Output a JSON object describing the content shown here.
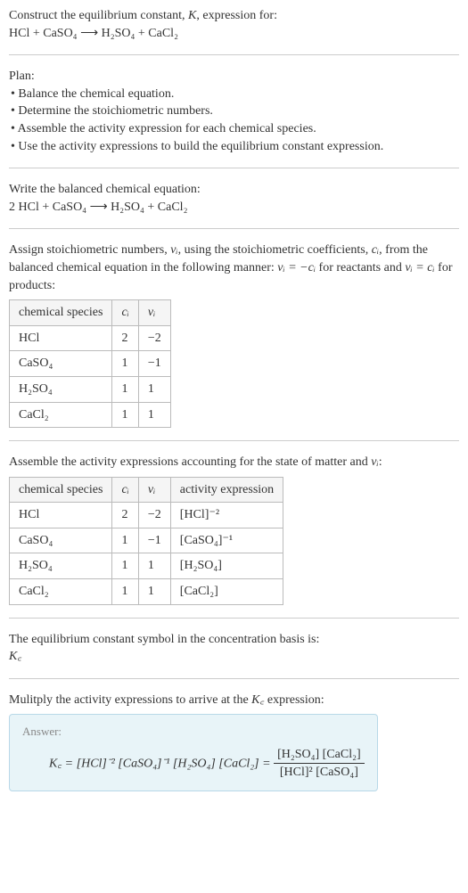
{
  "prompt": {
    "line1": "Construct the equilibrium constant, ",
    "K": "K",
    "line1b": ", expression for:",
    "equation": "HCl + CaSO₄  ⟶  H₂SO₄ + CaCl₂"
  },
  "plan": {
    "title": "Plan:",
    "bullets": [
      "• Balance the chemical equation.",
      "• Determine the stoichiometric numbers.",
      "• Assemble the activity expression for each chemical species.",
      "• Use the activity expressions to build the equilibrium constant expression."
    ]
  },
  "balanced": {
    "title": "Write the balanced chemical equation:",
    "equation": "2 HCl + CaSO₄  ⟶  H₂SO₄ + CaCl₂"
  },
  "stoich": {
    "intro1": "Assign stoichiometric numbers, ",
    "nu": "νᵢ",
    "intro2": ", using the stoichiometric coefficients, ",
    "ci": "cᵢ",
    "intro3": ", from the balanced chemical equation in the following manner: ",
    "rel1": "νᵢ = −cᵢ",
    "intro4": " for reactants and ",
    "rel2": "νᵢ = cᵢ",
    "intro5": " for products:",
    "headers": [
      "chemical species",
      "cᵢ",
      "νᵢ"
    ],
    "rows": [
      {
        "species": "HCl",
        "c": "2",
        "nu": "−2"
      },
      {
        "species": "CaSO₄",
        "c": "1",
        "nu": "−1"
      },
      {
        "species": "H₂SO₄",
        "c": "1",
        "nu": "1"
      },
      {
        "species": "CaCl₂",
        "c": "1",
        "nu": "1"
      }
    ]
  },
  "activity": {
    "title1": "Assemble the activity expressions accounting for the state of matter and ",
    "nu": "νᵢ",
    "title2": ":",
    "headers": [
      "chemical species",
      "cᵢ",
      "νᵢ",
      "activity expression"
    ],
    "rows": [
      {
        "species": "HCl",
        "c": "2",
        "nu": "−2",
        "expr": "[HCl]⁻²"
      },
      {
        "species": "CaSO₄",
        "c": "1",
        "nu": "−1",
        "expr": "[CaSO₄]⁻¹"
      },
      {
        "species": "H₂SO₄",
        "c": "1",
        "nu": "1",
        "expr": "[H₂SO₄]"
      },
      {
        "species": "CaCl₂",
        "c": "1",
        "nu": "1",
        "expr": "[CaCl₂]"
      }
    ]
  },
  "symbol": {
    "title": "The equilibrium constant symbol in the concentration basis is:",
    "value": "K꜀"
  },
  "multiply": {
    "title1": "Mulitply the activity expressions to arrive at the ",
    "kc": "K꜀",
    "title2": " expression:"
  },
  "answer": {
    "label": "Answer:",
    "lhs_pre": "K꜀ = [HCl]⁻² [CaSO₄]⁻¹ [H₂SO₄] [CaCl₂] = ",
    "num": "[H₂SO₄] [CaCl₂]",
    "den": "[HCl]² [CaSO₄]"
  },
  "chart_data": {
    "type": "table",
    "tables": [
      {
        "title": "Stoichiometric numbers",
        "headers": [
          "chemical species",
          "c_i",
          "nu_i"
        ],
        "rows": [
          [
            "HCl",
            2,
            -2
          ],
          [
            "CaSO4",
            1,
            -1
          ],
          [
            "H2SO4",
            1,
            1
          ],
          [
            "CaCl2",
            1,
            1
          ]
        ]
      },
      {
        "title": "Activity expressions",
        "headers": [
          "chemical species",
          "c_i",
          "nu_i",
          "activity expression"
        ],
        "rows": [
          [
            "HCl",
            2,
            -2,
            "[HCl]^-2"
          ],
          [
            "CaSO4",
            1,
            -1,
            "[CaSO4]^-1"
          ],
          [
            "H2SO4",
            1,
            1,
            "[H2SO4]"
          ],
          [
            "CaCl2",
            1,
            1,
            "[CaCl2]"
          ]
        ]
      }
    ]
  }
}
